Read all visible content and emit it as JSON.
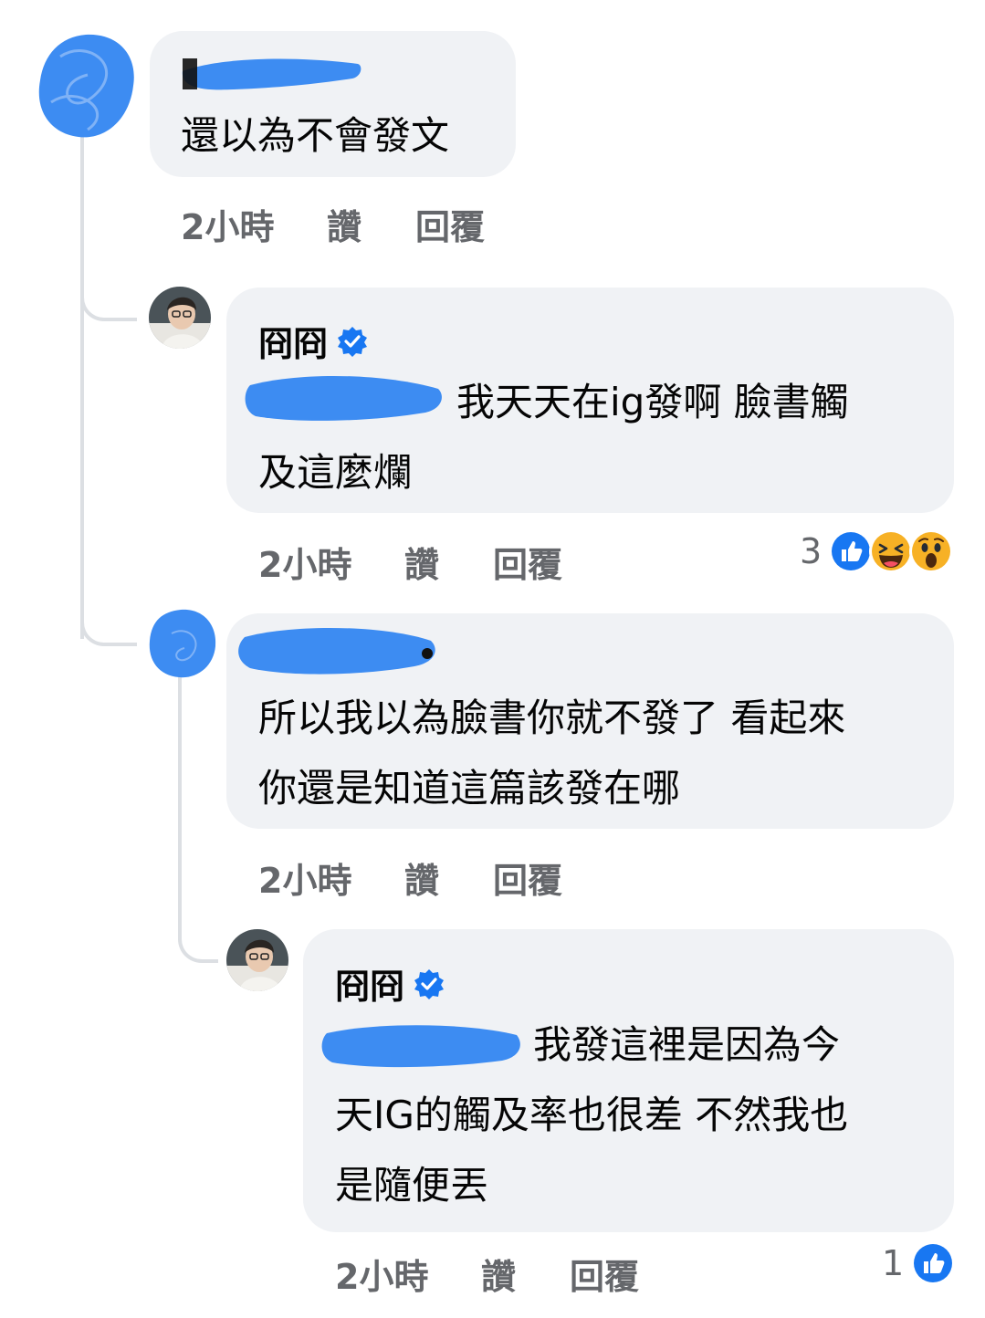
{
  "thread": {
    "comment1": {
      "name": "",
      "text": "還以為不會發文",
      "time": "2小時",
      "like": "讚",
      "reply": "回覆"
    },
    "reply1": {
      "name": "冏冏",
      "verified": true,
      "text_line1": "我天天在ig發啊 臉書觸",
      "text_line2": "及這麼爛",
      "time": "2小時",
      "like": "讚",
      "reply": "回覆",
      "reaction_count": "3",
      "reactions": [
        "like-icon",
        "haha-icon",
        "wow-icon"
      ]
    },
    "comment2": {
      "name": "",
      "text_line1": "所以我以為臉書你就不發了 看起來",
      "text_line2": "你還是知道這篇該發在哪",
      "time": "2小時",
      "like": "讚",
      "reply": "回覆"
    },
    "reply2": {
      "name": "冏冏",
      "verified": true,
      "text_line1": "我發這裡是因為今",
      "text_line2": "天IG的觸及率也很差 不然我也",
      "text_line3": "是隨便丟",
      "time": "2小時",
      "like": "讚",
      "reply": "回覆",
      "reaction_count": "1",
      "reactions": [
        "like-icon"
      ]
    }
  },
  "colors": {
    "bubble": "#f0f2f5",
    "meta_text": "#65676b",
    "redaction": "#3d8cf2",
    "like_blue": "#1877f2",
    "verified_blue": "#1877f2"
  }
}
